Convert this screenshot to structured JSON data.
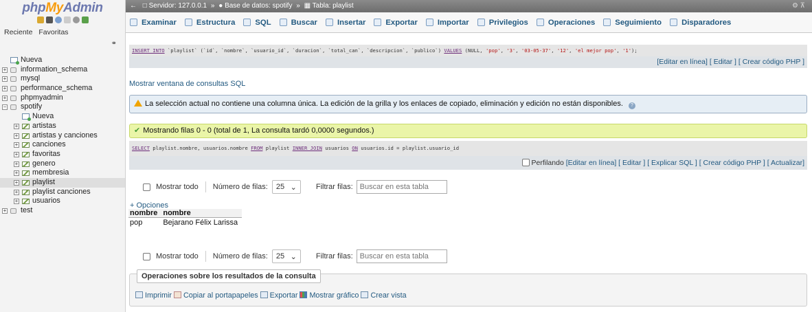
{
  "sidebar": {
    "logo_part1": "php",
    "logo_part2": "My",
    "logo_part3": "Admin",
    "tabs": [
      "Reciente",
      "Favoritas"
    ],
    "tree": [
      {
        "label": "Nueva",
        "level": 0,
        "type": "new"
      },
      {
        "label": "information_schema",
        "level": 0,
        "type": "db"
      },
      {
        "label": "mysql",
        "level": 0,
        "type": "db"
      },
      {
        "label": "performance_schema",
        "level": 0,
        "type": "db"
      },
      {
        "label": "phpmyadmin",
        "level": 0,
        "type": "db"
      },
      {
        "label": "spotify",
        "level": 0,
        "type": "db-open"
      },
      {
        "label": "Nueva",
        "level": 1,
        "type": "new"
      },
      {
        "label": "artistas",
        "level": 1,
        "type": "table"
      },
      {
        "label": "artistas y canciones",
        "level": 1,
        "type": "table"
      },
      {
        "label": "canciones",
        "level": 1,
        "type": "table"
      },
      {
        "label": "favoritas",
        "level": 1,
        "type": "table"
      },
      {
        "label": "genero",
        "level": 1,
        "type": "table"
      },
      {
        "label": "membresia",
        "level": 1,
        "type": "table"
      },
      {
        "label": "playlist",
        "level": 1,
        "type": "table",
        "selected": true
      },
      {
        "label": "playlist canciones",
        "level": 1,
        "type": "table"
      },
      {
        "label": "usuarios",
        "level": 1,
        "type": "table"
      },
      {
        "label": "test",
        "level": 0,
        "type": "db"
      }
    ]
  },
  "breadcrumb": {
    "server": "Servidor: 127.0.0.1",
    "database": "Base de datos: spotify",
    "table": "Tabla: playlist",
    "separator": "»"
  },
  "tabs": [
    "Examinar",
    "Estructura",
    "SQL",
    "Buscar",
    "Insertar",
    "Exportar",
    "Importar",
    "Privilegios",
    "Operaciones",
    "Seguimiento",
    "Disparadores"
  ],
  "insert_query": {
    "kw1": "INSERT INTO",
    "body1": " `playlist` (`id`, `nombre`, `usuario_id`, `duracion`, `total_can`, `descripcion`, `publico`) ",
    "kw2": "VALUES",
    "body2": " (NULL, ",
    "v1": "'pop'",
    "v2": "'3'",
    "v3": "'03-05-37'",
    "v4": "'12'",
    "v5": "'el mejor pop'",
    "v6": "'1'",
    "end": ");"
  },
  "actions_top": {
    "edit_inline": "[Editar en línea]",
    "edit": "[ Editar ]",
    "php": "[ Crear código PHP ]"
  },
  "show_sql_window": "Mostrar ventana de consultas SQL",
  "warning_text": "La selección actual no contiene una columna única. La edición de la grilla y los enlaces de copiado, eliminación y edición no están disponibles.",
  "success_text": "Mostrando filas 0 - 0 (total de 1, La consulta tardó 0,0000 segundos.)",
  "select_query": {
    "kw1": "SELECT",
    "b1": " playlist.nombre, usuarios.nombre ",
    "kw2": "FROM",
    "b2": " playlist ",
    "kw3": "INNER JOIN",
    "b3": " usuarios ",
    "kw4": "ON",
    "b4": " usuarios.id = playlist.usuario_id"
  },
  "actions_bottom": {
    "profiling": "Perfilando",
    "edit_inline": "[Editar en línea]",
    "edit": "[ Editar ]",
    "explain": "[ Explicar SQL ]",
    "php": "[ Crear código PHP ]",
    "refresh": "[ Actualizar]"
  },
  "nav_controls": {
    "show_all": "Mostrar todo",
    "rows_label": "Número de filas:",
    "rows_value": "25",
    "filter_label": "Filtrar filas:",
    "filter_placeholder": "Buscar en esta tabla"
  },
  "options_link": "+ Opciones",
  "results": {
    "columns": [
      "nombre",
      "nombre"
    ],
    "rows": [
      [
        "pop",
        "Bejarano Félix Larissa"
      ]
    ]
  },
  "ops": {
    "legend": "Operaciones sobre los resultados de la consulta",
    "print": "Imprimir",
    "copy": "Copiar al portapapeles",
    "export": "Exportar",
    "chart": "Mostrar gráfico",
    "view": "Crear vista"
  },
  "colors": {
    "link": "#235a81",
    "logo_blue": "#6c78af",
    "logo_orange": "#f89c0e",
    "success_bg": "#eaf5a8",
    "warning_bg": "#e6eef5"
  }
}
